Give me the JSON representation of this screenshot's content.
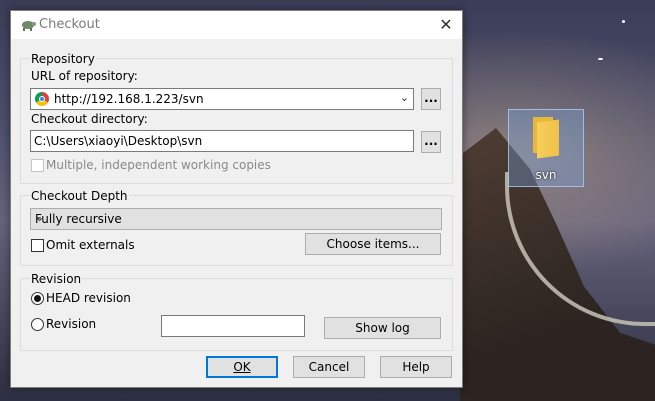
{
  "desktop": {
    "icon_label": "svn"
  },
  "dialog": {
    "title": "Checkout",
    "close_glyph": "✕"
  },
  "repository": {
    "group_label": "Repository",
    "url_label": "URL of repository:",
    "url_value": "http://192.168.1.223/svn",
    "dir_label": "Checkout directory:",
    "dir_value": "C:\\Users\\xiaoyi\\Desktop\\svn",
    "browse_label": "...",
    "multiple_label": "Multiple, independent working copies"
  },
  "depth": {
    "group_label": "Checkout Depth",
    "selected": "Fully recursive",
    "omit_label": "Omit externals",
    "choose_label": "Choose items..."
  },
  "revision": {
    "group_label": "Revision",
    "head_label": "HEAD revision",
    "revision_label": "Revision",
    "revision_value": "",
    "show_log_label": "Show log"
  },
  "buttons": {
    "ok": "OK",
    "cancel": "Cancel",
    "help": "Help"
  },
  "colors": {
    "accent": "#0078d7",
    "folder": "#f2c04a"
  },
  "icons": [
    "tortoise-icon",
    "close-icon",
    "chrome-icon",
    "chevron-down-icon",
    "folder-icon"
  ]
}
